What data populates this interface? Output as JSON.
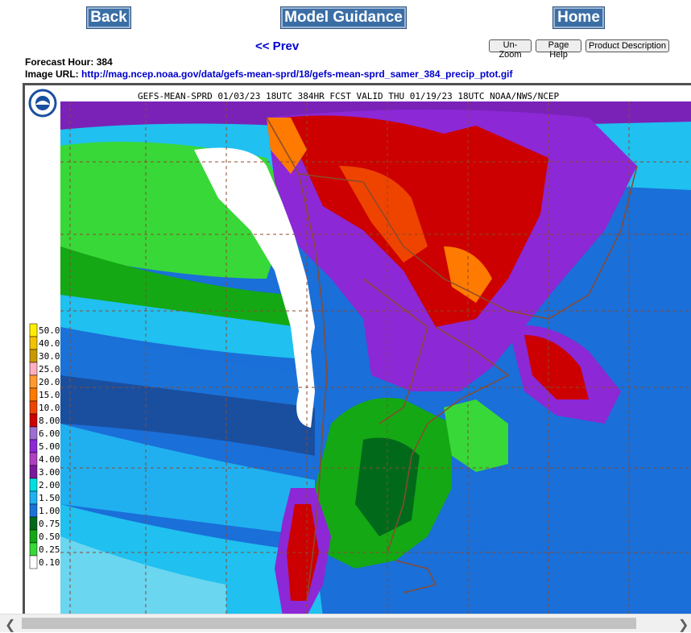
{
  "nav": {
    "back": "Back",
    "model_guidance": "Model Guidance",
    "home": "Home",
    "prev": "<< Prev"
  },
  "tools": {
    "unzoom": "Un-Zoom",
    "page_help": "Page Help",
    "product_description": "Product Description"
  },
  "info": {
    "forecast_hour_label": "Forecast Hour:",
    "forecast_hour": "384",
    "image_url_label": "Image URL:",
    "image_url": "http://mag.ncep.noaa.gov/data/gefs-mean-sprd/18/gefs-mean-sprd_samer_384_precip_ptot.gif"
  },
  "map": {
    "header": "GEFS-MEAN-SPRD 01/03/23 18UTC 384HR FCST VALID THU 01/19/23 18UTC NOAA/NWS/NCEP",
    "legend": [
      "50.0",
      "40.0",
      "30.0",
      "25.0",
      "20.0",
      "15.0",
      "10.0",
      "8.00",
      "6.00",
      "5.00",
      "4.00",
      "3.00",
      "2.00",
      "1.50",
      "1.00",
      "0.75",
      "0.50",
      "0.25",
      "0.10"
    ],
    "legend_colors": [
      "#ffee00",
      "#f2c300",
      "#c89a00",
      "#ffb0c0",
      "#ff9a30",
      "#ff7a00",
      "#ee4400",
      "#cc0000",
      "#9c6fd0",
      "#8c28d6",
      "#b040c0",
      "#7a1a9a",
      "#00e0e0",
      "#20b0f0",
      "#1a72d8",
      "#006a1a",
      "#14a814",
      "#38d838",
      "#ffffff"
    ],
    "colors": {
      "frame": "#505050",
      "border_lines": "#8b4a2e"
    }
  }
}
